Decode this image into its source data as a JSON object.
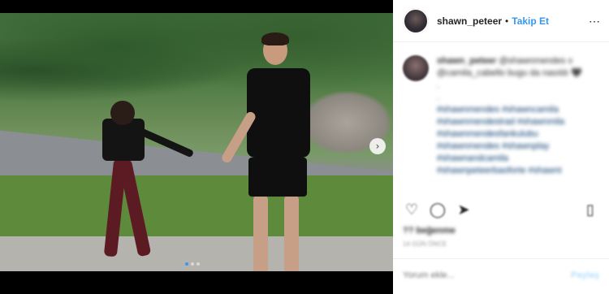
{
  "header": {
    "username": "shawn_peteer",
    "separator": "•",
    "follow_label": "Takip Et",
    "more_icon": "⋯"
  },
  "caption": {
    "username": "shawn_peteer",
    "text": "@shawnmendes x @camila_cabello bugu da nasıldı 🖤",
    "dots": [
      ".",
      "."
    ],
    "hashtags": [
      "#shawnmendes #shawncamila",
      "#shawnmendestrad #shawnmila",
      "#shawnmendesfankulubu",
      "#shawnmendes #shawnplay",
      "#shawnandcamila",
      "#shawnpeteerbaoforte #shawnt"
    ]
  },
  "icons": {
    "like": "heart-icon",
    "comment": "comment-icon",
    "share": "share-icon",
    "save": "bookmark-icon",
    "next": "chevron-right-icon"
  },
  "likes_text": "?? beğenme",
  "date_text": "14 gün önce",
  "comment": {
    "placeholder": "Yorum ekle...",
    "post_label": "Paylaş"
  },
  "carousel": {
    "total": 3,
    "active": 1
  },
  "colors": {
    "accent": "#3897f0",
    "text": "#262626"
  }
}
